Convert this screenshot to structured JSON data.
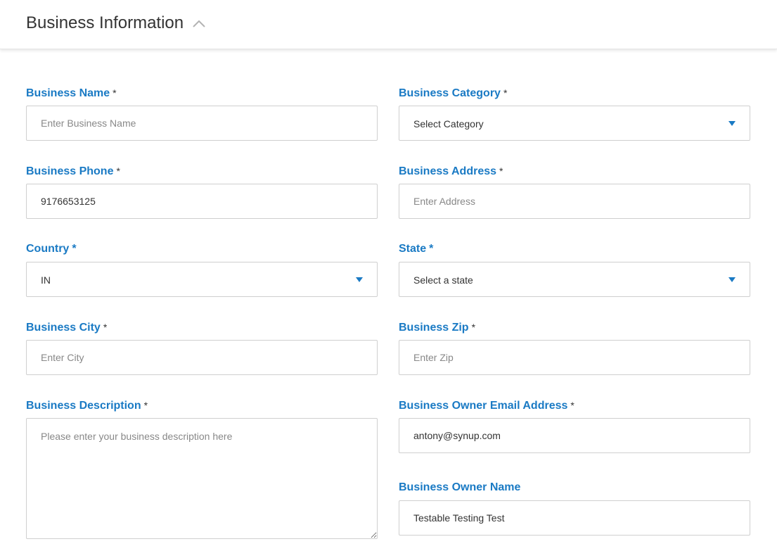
{
  "header": {
    "title": "Business Information"
  },
  "form": {
    "business_name": {
      "label": "Business Name",
      "required": "*",
      "placeholder": "Enter Business Name",
      "value": ""
    },
    "business_category": {
      "label": "Business Category",
      "required": "*",
      "value": "Select Category"
    },
    "business_phone": {
      "label": "Business Phone",
      "required": "*",
      "value": "9176653125"
    },
    "business_address": {
      "label": "Business Address",
      "required": "*",
      "placeholder": "Enter Address",
      "value": ""
    },
    "country": {
      "label": "Country",
      "required": "*",
      "value": "IN"
    },
    "state": {
      "label": "State",
      "required": "*",
      "value": "Select a state"
    },
    "business_city": {
      "label": "Business City",
      "required": "*",
      "placeholder": "Enter City",
      "value": ""
    },
    "business_zip": {
      "label": "Business Zip",
      "required": "*",
      "placeholder": "Enter Zip",
      "value": ""
    },
    "business_description": {
      "label": "Business Description",
      "required": "*",
      "placeholder": "Please enter your business description here",
      "value": ""
    },
    "owner_email": {
      "label": "Business Owner Email Address",
      "required": "*",
      "value": "antony@synup.com"
    },
    "owner_name": {
      "label": "Business Owner Name",
      "value": "Testable Testing Test"
    }
  },
  "icons": {
    "collapse": "chevron-up-icon",
    "dropdown": "caret-down-icon"
  },
  "colors": {
    "label": "#1a7ac4",
    "caret": "#1a7ac4",
    "border": "#cfcfcf"
  }
}
